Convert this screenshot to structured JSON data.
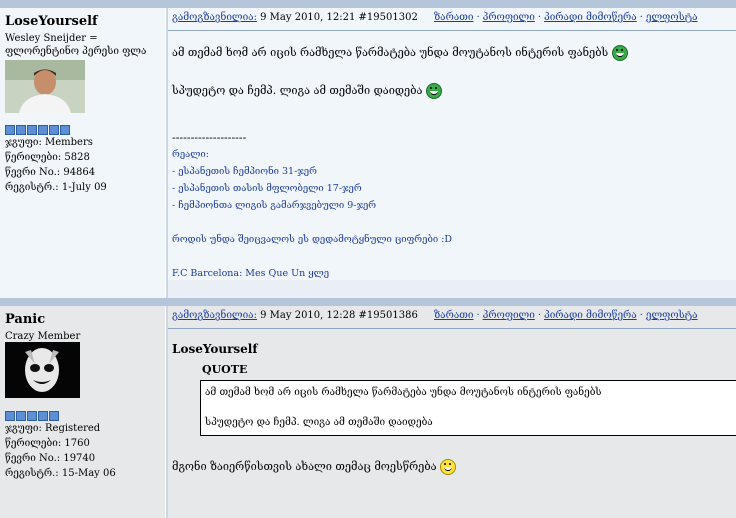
{
  "posts": [
    {
      "username": "LoseYourself",
      "title_line1": "Wesley Sneijder =",
      "title_line2": "ფლორენტინო პერესი ფლა",
      "group": "ჯგუფი: Members",
      "posts_count": "წერილები: 5828",
      "member_no": "წევრი No.: 94864",
      "registered": "რეგისტრ.: 1-July 09",
      "header_label": "გამოგზავნილია:",
      "header_date": "9 May 2010, 12:21",
      "post_id": "#19501302",
      "nav": [
        "ზარათი",
        "პროფილი",
        "პირადი მიმოწერა",
        "ელფოსტა"
      ],
      "text_line1": "ამ თემამ ხომ არ იცის რამხელა წარმატება უნდა მოუტანოს ინტერის ფანებს",
      "text_line2": "სპუდეტო და ჩემპ. ლიგა ამ თემაში დაიდება",
      "sig_dashes": "--------------------",
      "sig_lines": [
        "რეალი:",
        "- ესპანეთის ჩემპიონი 31-ჯერ",
        "- ესპანეთის თასის მფლობელი 17-ჯერ",
        "- ჩემპიონთა ლიგის გამარჯვებული 9-ჯერ",
        "",
        "როდის უნდა შეიცვალოს ეს დედამოტყნული ციფრები :D",
        "",
        "F.C Barcelona: Mes Que Un ყლე"
      ]
    },
    {
      "username": "Panic",
      "title_line1": "Crazy Member",
      "group": "ჯგუფი: Registered",
      "posts_count": "წერილები: 1760",
      "member_no": "წევრი No.: 19740",
      "registered": "რეგისტრ.: 15-May 06",
      "header_label": "გამოგზავნილია:",
      "header_date": "9 May 2010, 12:28",
      "post_id": "#19501386",
      "nav": [
        "ზარათი",
        "პროფილი",
        "პირადი მიმოწერა",
        "ელფოსტა"
      ],
      "quote_author": "LoseYourself",
      "quote_label": "QUOTE",
      "quote_line1": "ამ თემამ ხომ არ იცის რამხელა წარმატება უნდა მოუტანოს ინტერის ფანებს",
      "quote_line2": "სპუდეტო და ჩემპ. ლიგა ამ თემაში დაიდება",
      "reply_text": "მგონი ზაიერწისთვის ახალი თემაც მოესწრება"
    }
  ],
  "colors": {
    "link": "#1a3c9a",
    "separator": "#b5c6da",
    "post1_bg": "#f1f6fa",
    "post2_bg": "#e6e8ea"
  }
}
